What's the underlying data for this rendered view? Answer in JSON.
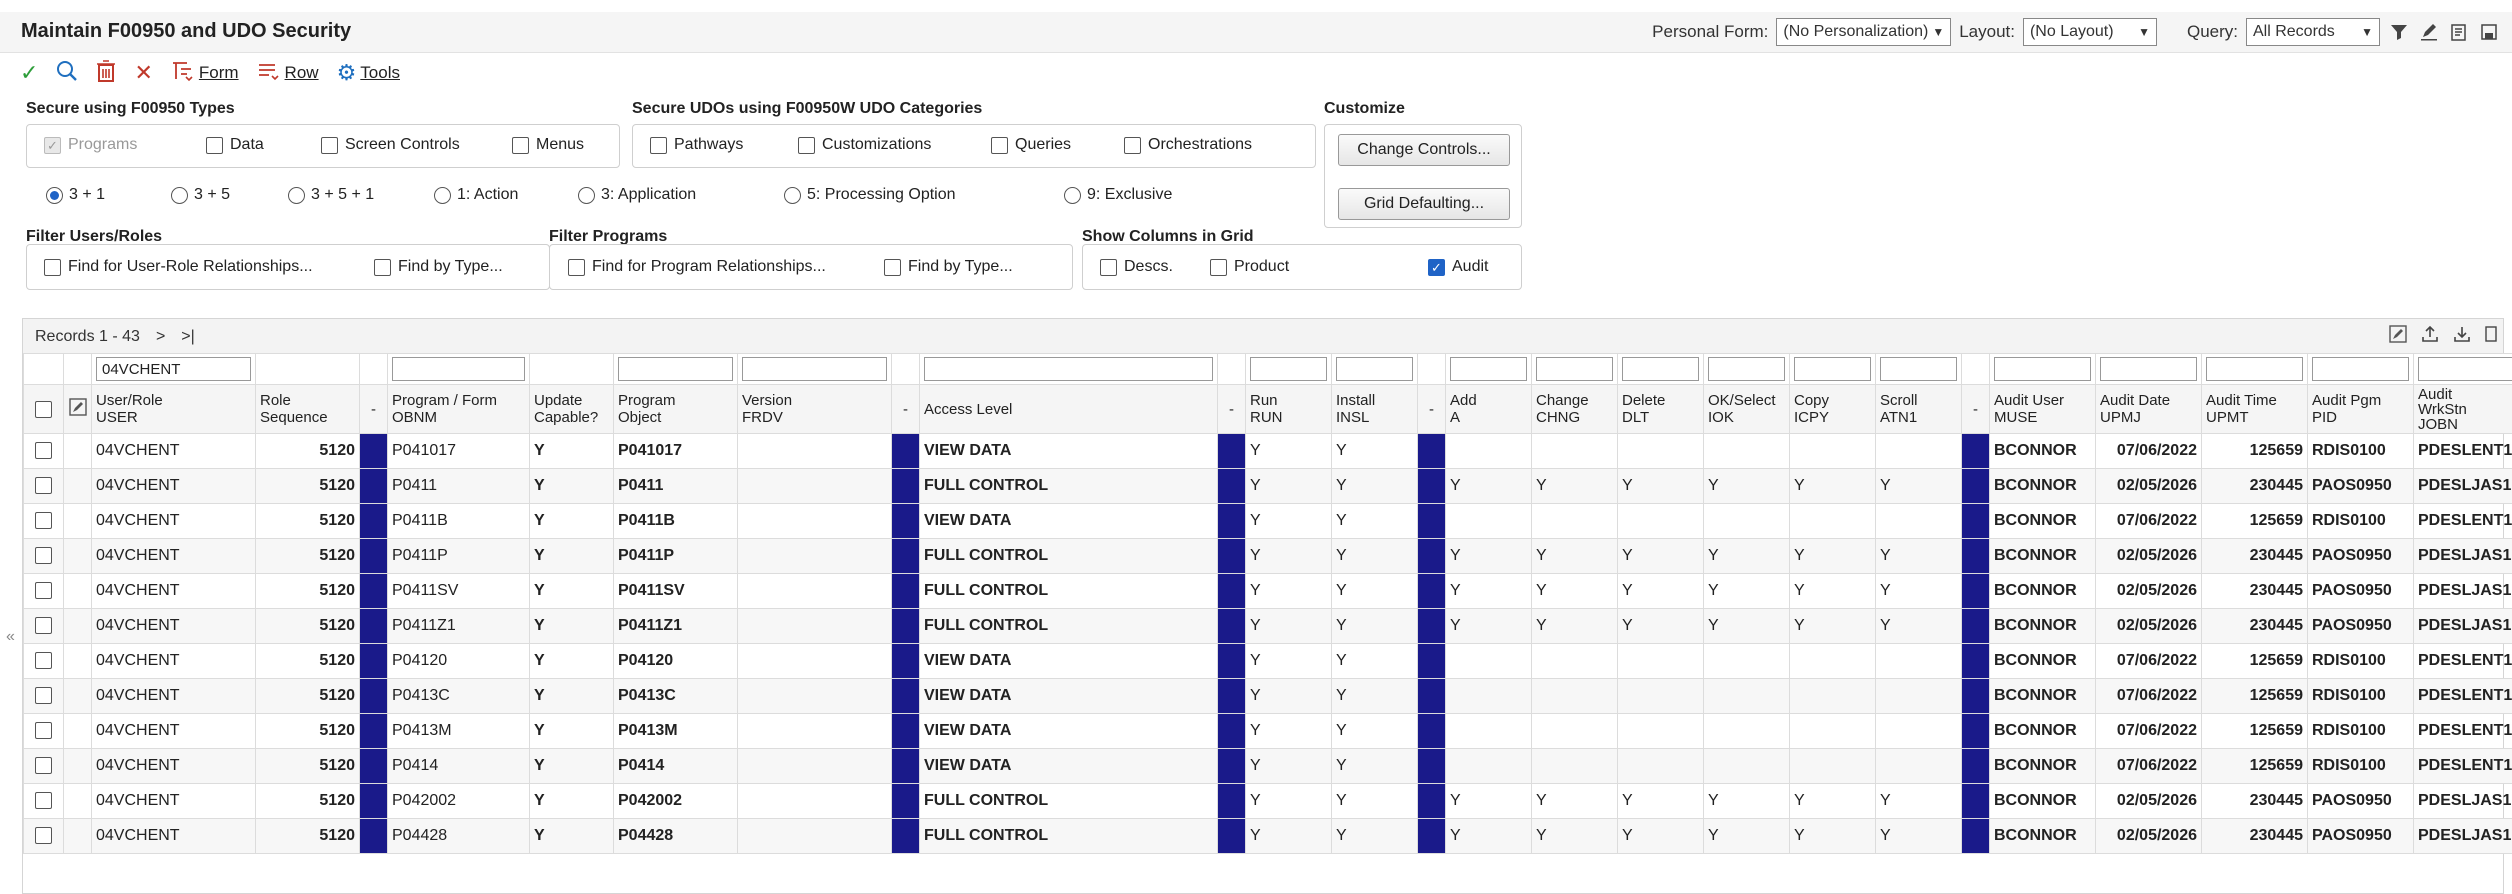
{
  "title": "Maintain F00950 and UDO Security",
  "header": {
    "personal_form_label": "Personal Form:",
    "personal_form_value": "(No Personalization)",
    "layout_label": "Layout:",
    "layout_value": "(No Layout)",
    "query_label": "Query:",
    "query_value": "All Records"
  },
  "toolbar": {
    "form_label": "Form",
    "row_label": "Row",
    "tools_label": "Tools"
  },
  "secure_f00950": {
    "label": "Secure using F00950 Types",
    "items": [
      "Programs",
      "Data",
      "Screen Controls",
      "Menus"
    ]
  },
  "secure_udo": {
    "label": "Secure UDOs using F00950W UDO Categories",
    "items": [
      "Pathways",
      "Customizations",
      "Queries",
      "Orchestrations"
    ]
  },
  "customize": {
    "label": "Customize",
    "change_controls": "Change Controls...",
    "grid_defaulting": "Grid Defaulting..."
  },
  "radios": [
    "3 + 1",
    "3 + 5",
    "3 + 5 + 1",
    "1: Action",
    "3: Application",
    "5: Processing Option",
    "9: Exclusive"
  ],
  "filter_users": {
    "label": "Filter Users/Roles",
    "find_relationships": "Find for User-Role Relationships...",
    "find_type": "Find by Type..."
  },
  "filter_programs": {
    "label": "Filter Programs",
    "find_relationships": "Find for Program Relationships...",
    "find_type": "Find by Type..."
  },
  "show_columns": {
    "label": "Show Columns in Grid",
    "descs": "Descs.",
    "product": "Product",
    "audit": "Audit"
  },
  "grid": {
    "records": "Records 1 - 43",
    "qbe_user": "04VCHENT",
    "headers": {
      "user": [
        "User/Role",
        "USER"
      ],
      "role_seq": [
        "Role",
        "Sequence"
      ],
      "dash": "-",
      "program_form": [
        "Program / Form",
        "OBNM"
      ],
      "update_capable": [
        "Update",
        "Capable?"
      ],
      "program_object": [
        "Program",
        "Object"
      ],
      "version": [
        "Version",
        "FRDV"
      ],
      "access_level": "Access Level",
      "run": [
        "Run",
        "RUN"
      ],
      "install": [
        "Install",
        "INSL"
      ],
      "add": [
        "Add",
        "A"
      ],
      "change": [
        "Change",
        "CHNG"
      ],
      "delete": [
        "Delete",
        "DLT"
      ],
      "ok_select": [
        "OK/Select",
        "IOK"
      ],
      "copy": [
        "Copy",
        "ICPY"
      ],
      "scroll": [
        "Scroll",
        "ATN1"
      ],
      "audit_user": [
        "Audit User",
        "MUSE"
      ],
      "audit_date": [
        "Audit Date",
        "UPMJ"
      ],
      "audit_time": [
        "Audit Time",
        "UPMT"
      ],
      "audit_pgm": [
        "Audit Pgm",
        "PID"
      ],
      "audit_wks": [
        "Audit",
        "WrkStn",
        "JOBN"
      ]
    },
    "rows": [
      {
        "user": "04VCHENT",
        "seq": "5120",
        "obnm": "P041017",
        "upd": "Y",
        "obj": "P041017",
        "ver": "",
        "access": "VIEW DATA",
        "run": "Y",
        "insl": "Y",
        "a": "",
        "chng": "",
        "dlt": "",
        "iok": "",
        "icpy": "",
        "atn1": "",
        "muse": "BCONNOR",
        "upmj": "07/06/2022",
        "upmt": "125659",
        "pid": "RDIS0100",
        "jobn": "PDESLENT1"
      },
      {
        "user": "04VCHENT",
        "seq": "5120",
        "obnm": "P0411",
        "upd": "Y",
        "obj": "P0411",
        "ver": "",
        "access": "FULL CONTROL",
        "run": "Y",
        "insl": "Y",
        "a": "Y",
        "chng": "Y",
        "dlt": "Y",
        "iok": "Y",
        "icpy": "Y",
        "atn1": "Y",
        "muse": "BCONNOR",
        "upmj": "02/05/2026",
        "upmt": "230445",
        "pid": "PAOS0950",
        "jobn": "PDESLJAS1"
      },
      {
        "user": "04VCHENT",
        "seq": "5120",
        "obnm": "P0411B",
        "upd": "Y",
        "obj": "P0411B",
        "ver": "",
        "access": "VIEW DATA",
        "run": "Y",
        "insl": "Y",
        "a": "",
        "chng": "",
        "dlt": "",
        "iok": "",
        "icpy": "",
        "atn1": "",
        "muse": "BCONNOR",
        "upmj": "07/06/2022",
        "upmt": "125659",
        "pid": "RDIS0100",
        "jobn": "PDESLENT1"
      },
      {
        "user": "04VCHENT",
        "seq": "5120",
        "obnm": "P0411P",
        "upd": "Y",
        "obj": "P0411P",
        "ver": "",
        "access": "FULL CONTROL",
        "run": "Y",
        "insl": "Y",
        "a": "Y",
        "chng": "Y",
        "dlt": "Y",
        "iok": "Y",
        "icpy": "Y",
        "atn1": "Y",
        "muse": "BCONNOR",
        "upmj": "02/05/2026",
        "upmt": "230445",
        "pid": "PAOS0950",
        "jobn": "PDESLJAS1"
      },
      {
        "user": "04VCHENT",
        "seq": "5120",
        "obnm": "P0411SV",
        "upd": "Y",
        "obj": "P0411SV",
        "ver": "",
        "access": "FULL CONTROL",
        "run": "Y",
        "insl": "Y",
        "a": "Y",
        "chng": "Y",
        "dlt": "Y",
        "iok": "Y",
        "icpy": "Y",
        "atn1": "Y",
        "muse": "BCONNOR",
        "upmj": "02/05/2026",
        "upmt": "230445",
        "pid": "PAOS0950",
        "jobn": "PDESLJAS1"
      },
      {
        "user": "04VCHENT",
        "seq": "5120",
        "obnm": "P0411Z1",
        "upd": "Y",
        "obj": "P0411Z1",
        "ver": "",
        "access": "FULL CONTROL",
        "run": "Y",
        "insl": "Y",
        "a": "Y",
        "chng": "Y",
        "dlt": "Y",
        "iok": "Y",
        "icpy": "Y",
        "atn1": "Y",
        "muse": "BCONNOR",
        "upmj": "02/05/2026",
        "upmt": "230445",
        "pid": "PAOS0950",
        "jobn": "PDESLJAS1"
      },
      {
        "user": "04VCHENT",
        "seq": "5120",
        "obnm": "P04120",
        "upd": "Y",
        "obj": "P04120",
        "ver": "",
        "access": "VIEW DATA",
        "run": "Y",
        "insl": "Y",
        "a": "",
        "chng": "",
        "dlt": "",
        "iok": "",
        "icpy": "",
        "atn1": "",
        "muse": "BCONNOR",
        "upmj": "07/06/2022",
        "upmt": "125659",
        "pid": "RDIS0100",
        "jobn": "PDESLENT1"
      },
      {
        "user": "04VCHENT",
        "seq": "5120",
        "obnm": "P0413C",
        "upd": "Y",
        "obj": "P0413C",
        "ver": "",
        "access": "VIEW DATA",
        "run": "Y",
        "insl": "Y",
        "a": "",
        "chng": "",
        "dlt": "",
        "iok": "",
        "icpy": "",
        "atn1": "",
        "muse": "BCONNOR",
        "upmj": "07/06/2022",
        "upmt": "125659",
        "pid": "RDIS0100",
        "jobn": "PDESLENT1"
      },
      {
        "user": "04VCHENT",
        "seq": "5120",
        "obnm": "P0413M",
        "upd": "Y",
        "obj": "P0413M",
        "ver": "",
        "access": "VIEW DATA",
        "run": "Y",
        "insl": "Y",
        "a": "",
        "chng": "",
        "dlt": "",
        "iok": "",
        "icpy": "",
        "atn1": "",
        "muse": "BCONNOR",
        "upmj": "07/06/2022",
        "upmt": "125659",
        "pid": "RDIS0100",
        "jobn": "PDESLENT1"
      },
      {
        "user": "04VCHENT",
        "seq": "5120",
        "obnm": "P0414",
        "upd": "Y",
        "obj": "P0414",
        "ver": "",
        "access": "VIEW DATA",
        "run": "Y",
        "insl": "Y",
        "a": "",
        "chng": "",
        "dlt": "",
        "iok": "",
        "icpy": "",
        "atn1": "",
        "muse": "BCONNOR",
        "upmj": "07/06/2022",
        "upmt": "125659",
        "pid": "RDIS0100",
        "jobn": "PDESLENT1"
      },
      {
        "user": "04VCHENT",
        "seq": "5120",
        "obnm": "P042002",
        "upd": "Y",
        "obj": "P042002",
        "ver": "",
        "access": "FULL CONTROL",
        "run": "Y",
        "insl": "Y",
        "a": "Y",
        "chng": "Y",
        "dlt": "Y",
        "iok": "Y",
        "icpy": "Y",
        "atn1": "Y",
        "muse": "BCONNOR",
        "upmj": "02/05/2026",
        "upmt": "230445",
        "pid": "PAOS0950",
        "jobn": "PDESLJAS1"
      },
      {
        "user": "04VCHENT",
        "seq": "5120",
        "obnm": "P04428",
        "upd": "Y",
        "obj": "P04428",
        "ver": "",
        "access": "FULL CONTROL",
        "run": "Y",
        "insl": "Y",
        "a": "Y",
        "chng": "Y",
        "dlt": "Y",
        "iok": "Y",
        "icpy": "Y",
        "atn1": "Y",
        "muse": "BCONNOR",
        "upmj": "02/05/2026",
        "upmt": "230445",
        "pid": "PAOS0950",
        "jobn": "PDESLJAS1"
      }
    ]
  },
  "colors": {
    "accent_bar": "#1a1a8a",
    "link": "#1a1aa0",
    "check": "#1f63c6"
  }
}
